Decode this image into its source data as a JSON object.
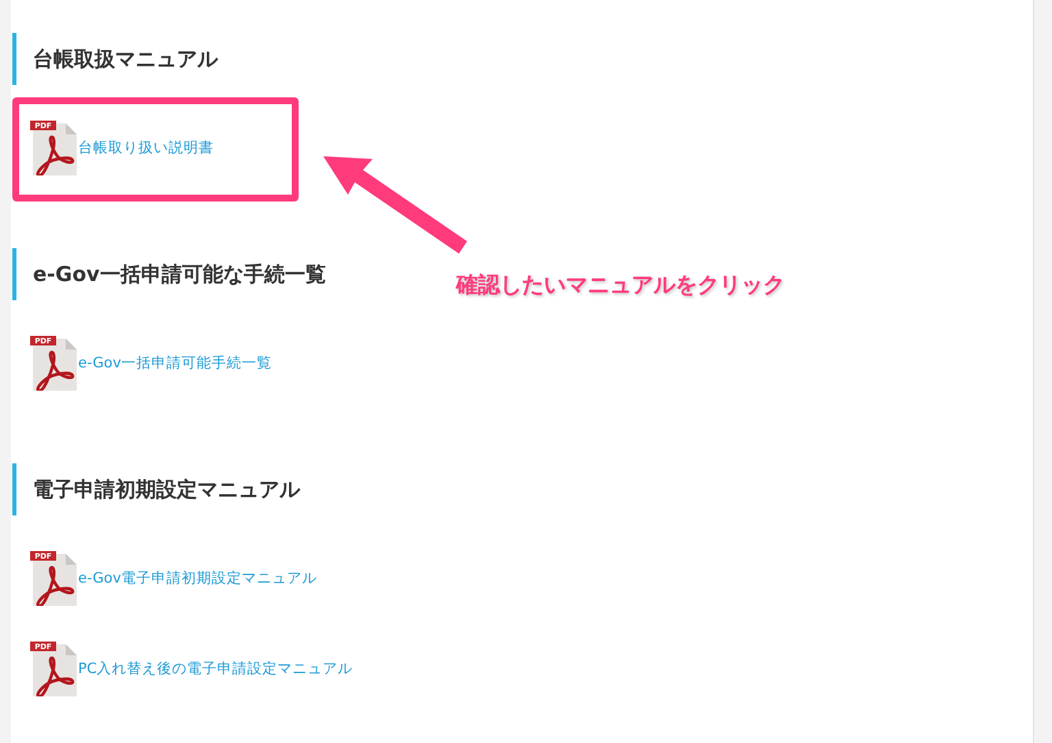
{
  "sections": [
    {
      "heading": "台帳取扱マニュアル",
      "items": [
        {
          "icon_label": "PDF",
          "label": "台帳取り扱い説明書",
          "highlighted": true
        }
      ]
    },
    {
      "heading": "e-Gov一括申請可能な手続一覧",
      "items": [
        {
          "icon_label": "PDF",
          "label": "e-Gov一括申請可能手続一覧",
          "highlighted": false
        }
      ]
    },
    {
      "heading": "電子申請初期設定マニュアル",
      "items": [
        {
          "icon_label": "PDF",
          "label": "e-Gov電子申請初期設定マニュアル",
          "highlighted": false
        },
        {
          "icon_label": "PDF",
          "label": "PC入れ替え後の電子申請設定マニュアル",
          "highlighted": false
        }
      ]
    }
  ],
  "annotation": {
    "text": "確認したいマニュアルをクリック"
  }
}
